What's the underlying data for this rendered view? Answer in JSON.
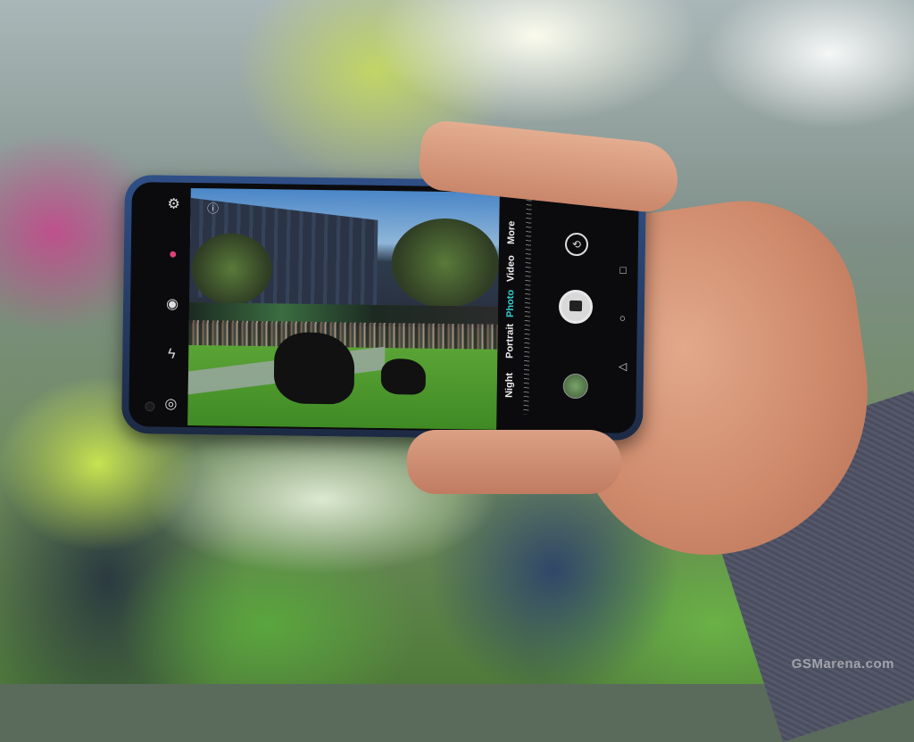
{
  "camera": {
    "modes": [
      {
        "label": "Night",
        "active": false
      },
      {
        "label": "Portrait",
        "active": false
      },
      {
        "label": "Photo",
        "active": true
      },
      {
        "label": "Video",
        "active": false
      },
      {
        "label": "More",
        "active": false
      }
    ]
  },
  "icons": {
    "settings": "gear-icon",
    "ai": "ai-color-icon",
    "aperture": "aperture-icon",
    "flash_off": "flash-off-icon",
    "filter": "filter-icon",
    "info": "info-icon",
    "switch_camera": "switch-camera-icon",
    "shutter": "camera-shutter-icon",
    "recent_apps": "square-nav-icon",
    "home": "circle-nav-icon",
    "back": "triangle-back-icon"
  },
  "colors": {
    "active_mode": "#2fd0d0",
    "phone_body": "#2f4f86"
  },
  "watermark": "GSMarena.com"
}
